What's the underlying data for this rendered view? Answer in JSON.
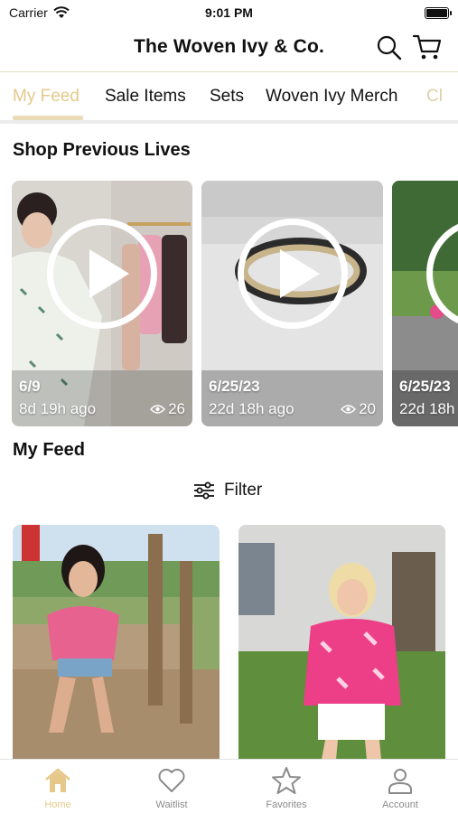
{
  "status_bar": {
    "carrier": "Carrier",
    "time": "9:01 PM"
  },
  "header": {
    "title": "The Woven Ivy & Co."
  },
  "tabs": [
    {
      "label": "My Feed",
      "active": true
    },
    {
      "label": "Sale Items",
      "active": false
    },
    {
      "label": "Sets",
      "active": false
    },
    {
      "label": "Woven Ivy Merch",
      "active": false
    },
    {
      "label": "Cl",
      "active": false
    }
  ],
  "sections": {
    "previous_lives": "Shop Previous Lives",
    "my_feed": "My Feed"
  },
  "lives": [
    {
      "date": "6/9",
      "ago": "8d 19h ago",
      "views": "26"
    },
    {
      "date": "6/25/23",
      "ago": "22d 18h ago",
      "views": "20"
    },
    {
      "date": "6/25/23",
      "ago": "22d 18h",
      "views": ""
    }
  ],
  "filter": {
    "label": "Filter"
  },
  "bottom_nav": [
    {
      "label": "Home",
      "icon": "home-icon",
      "active": true
    },
    {
      "label": "Waitlist",
      "icon": "heart-icon",
      "active": false
    },
    {
      "label": "Favorites",
      "icon": "star-icon",
      "active": false
    },
    {
      "label": "Account",
      "icon": "person-icon",
      "active": false
    }
  ],
  "colors": {
    "accent": "#e6c98a",
    "tab_underline": "#eadcb8",
    "divider": "#ececec"
  }
}
